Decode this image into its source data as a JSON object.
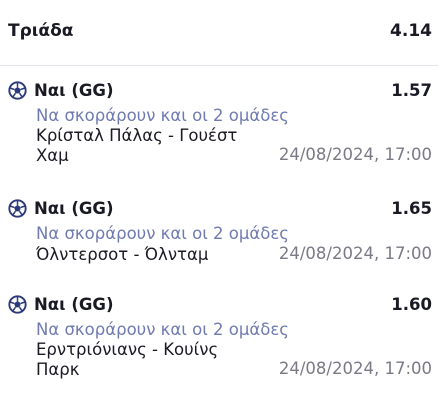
{
  "summary": {
    "label": "Τριάδα",
    "odds": "4.14"
  },
  "selections": [
    {
      "pick": "Ναι (GG)",
      "odds": "1.57",
      "market": "Να σκοράρουν και οι 2 ομάδες",
      "teams": "Κρίσταλ Πάλας - Γουέστ Χαμ",
      "datetime": "24/08/2024, 17:00",
      "icon": "soccer-ball-icon"
    },
    {
      "pick": "Ναι (GG)",
      "odds": "1.65",
      "market": "Να σκοράρουν και οι 2 ομάδες",
      "teams": "Όλντερσοτ - Όλνταμ",
      "datetime": "24/08/2024, 17:00",
      "icon": "soccer-ball-icon"
    },
    {
      "pick": "Ναι (GG)",
      "odds": "1.60",
      "market": "Να σκοράρουν και οι 2 ομάδες",
      "teams": "Ερντριόνιανς - Κουίνς Παρκ",
      "datetime": "24/08/2024, 17:00",
      "icon": "soccer-ball-icon"
    }
  ],
  "colors": {
    "market_text": "#6f7ab0",
    "datetime_text": "#7a7a86",
    "primary_text": "#1a1a24",
    "ball": "#2b3a7a"
  }
}
